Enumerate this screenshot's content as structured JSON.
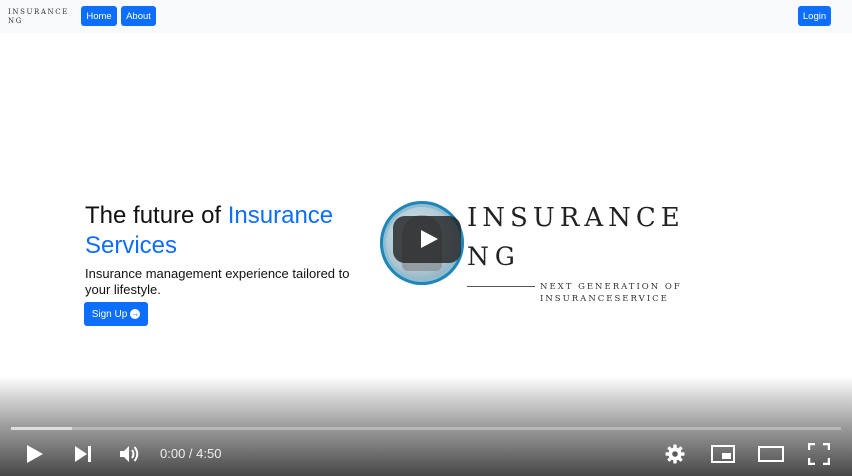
{
  "navbar": {
    "brand_line1": "INSURANCE",
    "brand_line2": "NG",
    "home_label": "Home",
    "about_label": "About",
    "login_label": "Login"
  },
  "hero": {
    "title_prefix": "The future of ",
    "title_accent": "Insurance Services",
    "subtitle": "Insurance management experience tailored to your lifestyle.",
    "signup_label": "Sign Up"
  },
  "logo": {
    "word1": "INSURANCE",
    "word2": "NG",
    "tagline_line1": "NEXT GENERATION OF",
    "tagline_line2": "INSURANCESERVICE"
  },
  "player": {
    "time_display": "0:00 / 4:50",
    "progress_fraction": 0.0,
    "icons": [
      "play-icon",
      "next-icon",
      "volume-icon",
      "settings-icon",
      "miniplayer-icon",
      "theater-mode-icon",
      "fullscreen-icon"
    ]
  },
  "colors": {
    "accent": "#0d6efd",
    "navbar_bg": "#f8f9fa",
    "progress_played": "#ff0000"
  }
}
